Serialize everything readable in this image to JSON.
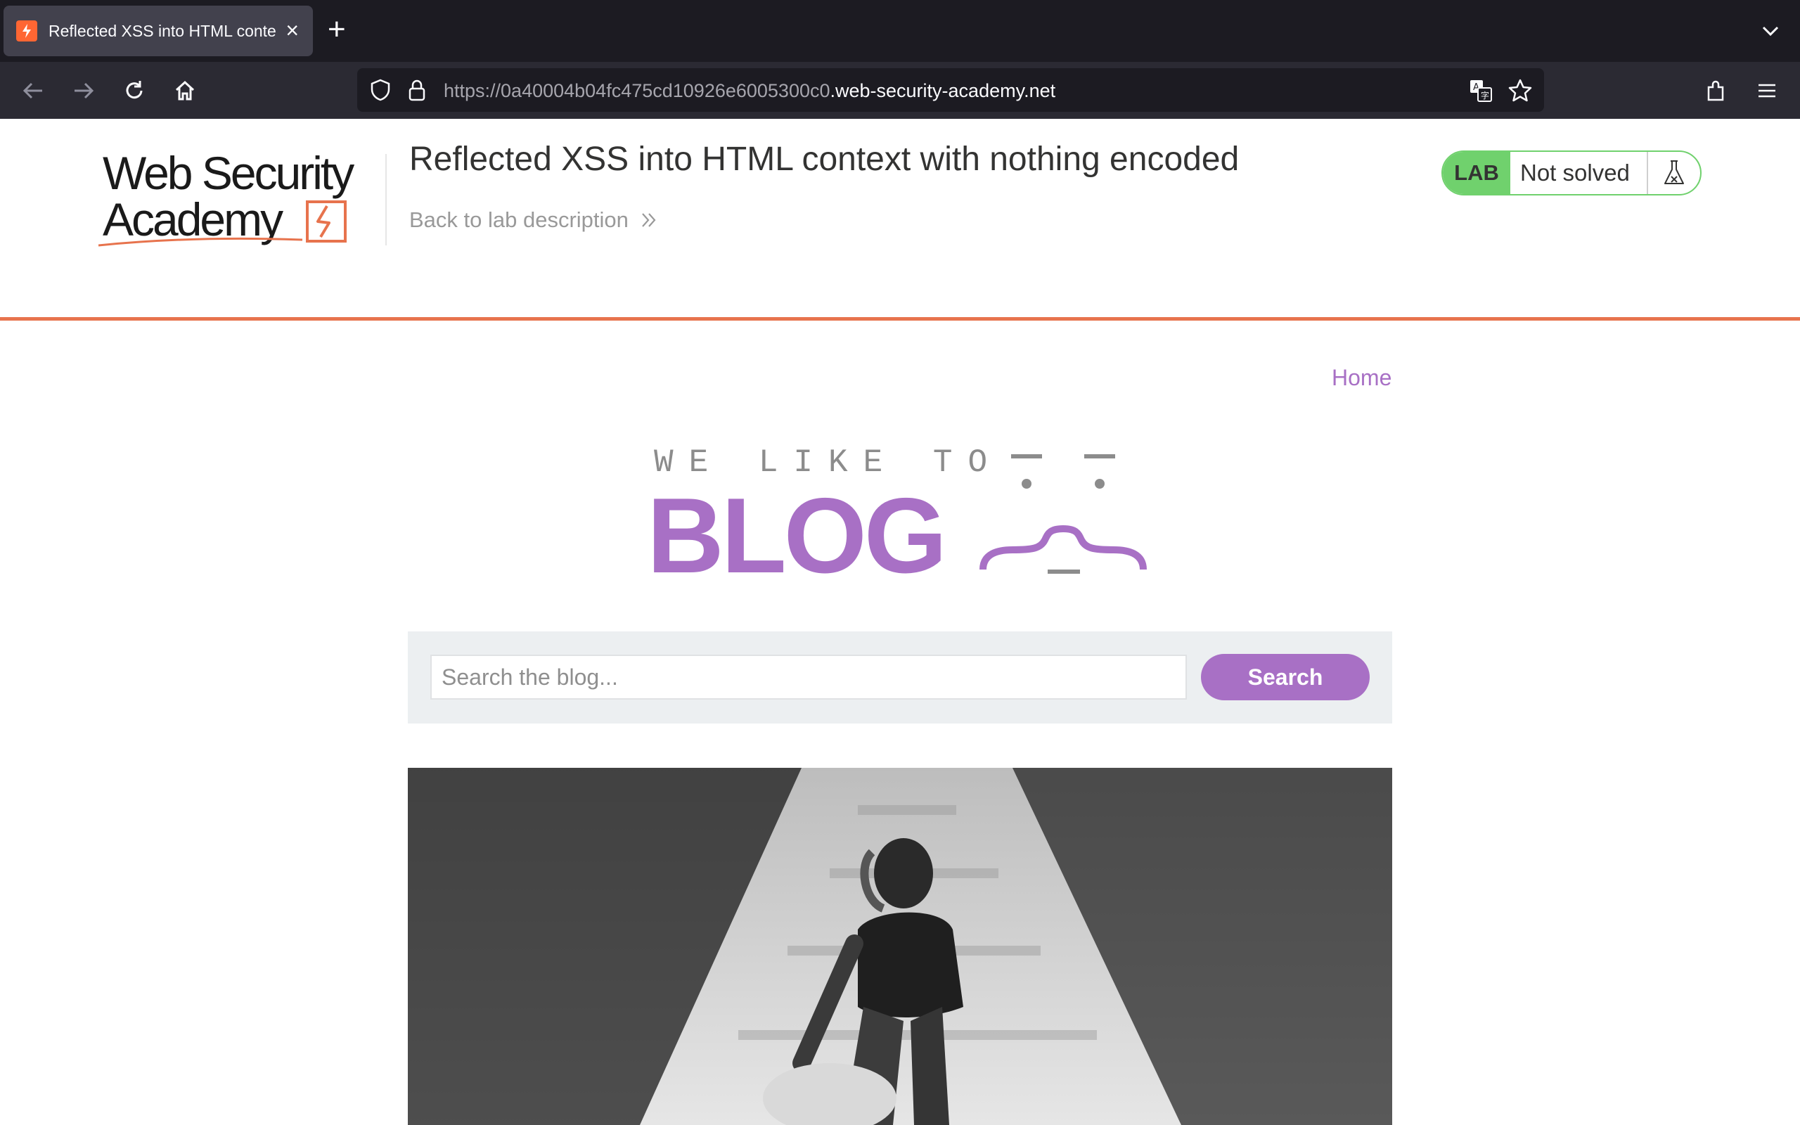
{
  "browser": {
    "tab_title": "Reflected XSS into HTML conte",
    "url_prefix": "https://0a40004b04fc475cd10926e6005300c0",
    "url_domain": ".web-security-academy.net"
  },
  "lab": {
    "logo_line1": "Web Security",
    "logo_line2": "Academy",
    "title": "Reflected XSS into HTML context with nothing encoded",
    "back_link": "Back to lab description",
    "status_tag": "LAB",
    "status": "Not solved"
  },
  "blog": {
    "nav_home": "Home",
    "logo_top": "WE LIKE TO",
    "logo_main": "BLOG",
    "search_placeholder": "Search the blog...",
    "search_button": "Search"
  },
  "colors": {
    "accent_purple": "#a870c5",
    "lab_orange": "#e7734d",
    "lab_green": "#70d16d"
  }
}
